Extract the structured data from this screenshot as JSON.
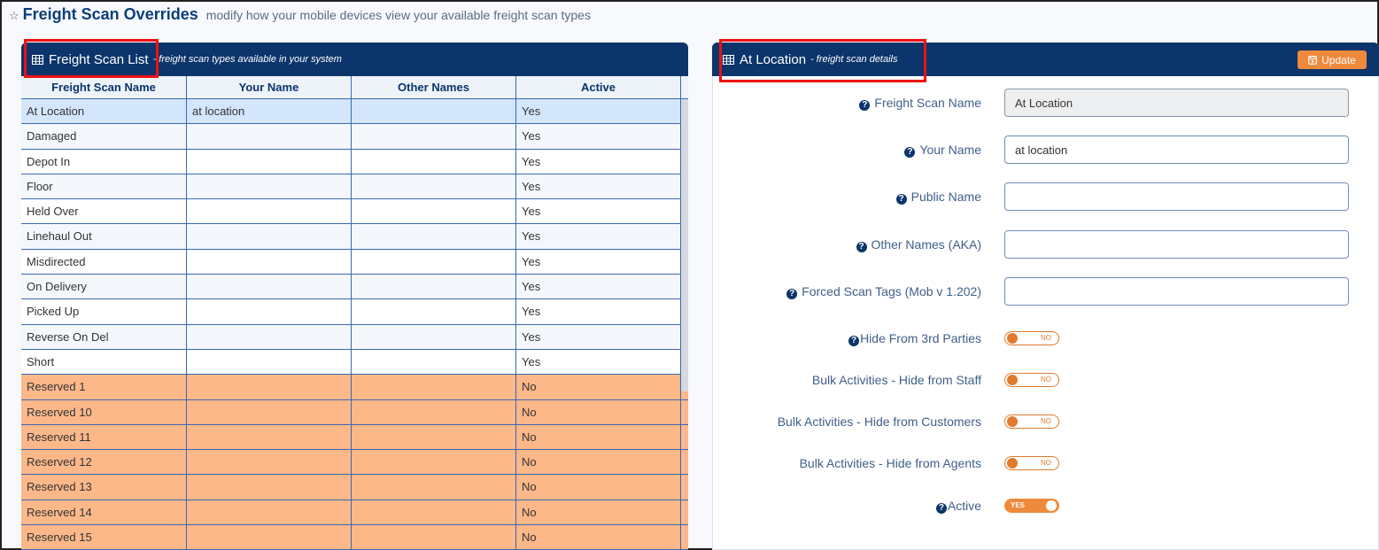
{
  "page": {
    "star_icon": "star-outline-icon",
    "title": "Freight Scan Overrides",
    "subtitle": "modify how your mobile devices view your available freight scan types"
  },
  "list_panel": {
    "icon": "table-grid-icon",
    "title": "Freight Scan List",
    "subtitle": "- freight scan types available in your system",
    "columns": [
      "Freight Scan Name",
      "Your Name",
      "Other Names",
      "Active"
    ],
    "rows": [
      {
        "name": "At Location",
        "your_name": "at location",
        "other_names": "",
        "active": "Yes"
      },
      {
        "name": "Damaged",
        "your_name": "",
        "other_names": "",
        "active": "Yes"
      },
      {
        "name": "Depot In",
        "your_name": "",
        "other_names": "",
        "active": "Yes"
      },
      {
        "name": "Floor",
        "your_name": "",
        "other_names": "",
        "active": "Yes"
      },
      {
        "name": "Held Over",
        "your_name": "",
        "other_names": "",
        "active": "Yes"
      },
      {
        "name": "Linehaul Out",
        "your_name": "",
        "other_names": "",
        "active": "Yes"
      },
      {
        "name": "Misdirected",
        "your_name": "",
        "other_names": "",
        "active": "Yes"
      },
      {
        "name": "On Delivery",
        "your_name": "",
        "other_names": "",
        "active": "Yes"
      },
      {
        "name": "Picked Up",
        "your_name": "",
        "other_names": "",
        "active": "Yes"
      },
      {
        "name": "Reverse On Del",
        "your_name": "",
        "other_names": "",
        "active": "Yes"
      },
      {
        "name": "Short",
        "your_name": "",
        "other_names": "",
        "active": "Yes"
      },
      {
        "name": "Reserved 1",
        "your_name": "",
        "other_names": "",
        "active": "No"
      },
      {
        "name": "Reserved 10",
        "your_name": "",
        "other_names": "",
        "active": "No"
      },
      {
        "name": "Reserved 11",
        "your_name": "",
        "other_names": "",
        "active": "No"
      },
      {
        "name": "Reserved 12",
        "your_name": "",
        "other_names": "",
        "active": "No"
      },
      {
        "name": "Reserved 13",
        "your_name": "",
        "other_names": "",
        "active": "No"
      },
      {
        "name": "Reserved 14",
        "your_name": "",
        "other_names": "",
        "active": "No"
      },
      {
        "name": "Reserved 15",
        "your_name": "",
        "other_names": "",
        "active": "No"
      },
      {
        "name": "",
        "your_name": "",
        "other_names": "",
        "active": ""
      }
    ]
  },
  "detail_panel": {
    "icon": "table-grid-icon",
    "title": "At Location",
    "subtitle": "- freight scan details",
    "update_label": "Update",
    "update_icon": "save-icon",
    "fields": {
      "freight_scan_name": {
        "label": "Freight Scan Name",
        "value": "At Location"
      },
      "your_name": {
        "label": "Your Name",
        "value": "at location"
      },
      "public_name": {
        "label": "Public Name",
        "value": ""
      },
      "other_names": {
        "label": "Other Names (AKA)",
        "value": ""
      },
      "forced_scan_tags": {
        "label": "Forced Scan Tags (Mob v 1.202)",
        "value": ""
      }
    },
    "toggles": {
      "hide_3rd": {
        "label": "Hide From 3rd Parties",
        "state": "NO"
      },
      "bulk_staff": {
        "label": "Bulk Activities - Hide from Staff",
        "state": "NO"
      },
      "bulk_customers": {
        "label": "Bulk Activities - Hide from Customers",
        "state": "NO"
      },
      "bulk_agents": {
        "label": "Bulk Activities - Hide from Agents",
        "state": "NO"
      },
      "active": {
        "label": "Active",
        "state": "YES"
      }
    }
  },
  "colors": {
    "header_navy": "#0b356b",
    "accent_orange": "#ef8a3c",
    "reserved_row": "#fdb88a",
    "selected_row": "#d4e6fb",
    "highlight_red": "#ee1111"
  }
}
